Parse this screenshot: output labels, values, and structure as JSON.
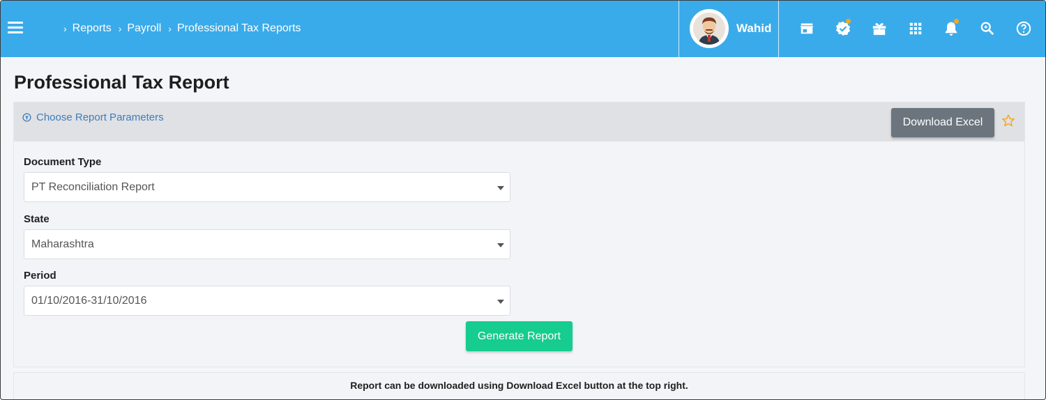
{
  "header": {
    "breadcrumb": [
      "Reports",
      "Payroll",
      "Professional Tax Reports"
    ],
    "user_name": "Wahid",
    "icons": [
      "menu-icon",
      "store-icon",
      "verified-badge-icon",
      "gift-icon",
      "apps-grid-icon",
      "bell-icon",
      "search-icon",
      "help-icon"
    ],
    "accent_color": "#3aabea",
    "notification_dot_color": "#f5a623"
  },
  "page": {
    "title": "Professional Tax Report"
  },
  "panel": {
    "choose_params_label": "Choose Report Parameters",
    "download_label": "Download Excel",
    "fields": [
      {
        "label": "Document Type",
        "value": "PT Reconciliation Report"
      },
      {
        "label": "State",
        "value": "Maharashtra"
      },
      {
        "label": "Period",
        "value": "01/10/2016-31/10/2016"
      }
    ],
    "generate_label": "Generate Report"
  },
  "footer": {
    "note": "Report can be downloaded using Download Excel button at the top right."
  }
}
